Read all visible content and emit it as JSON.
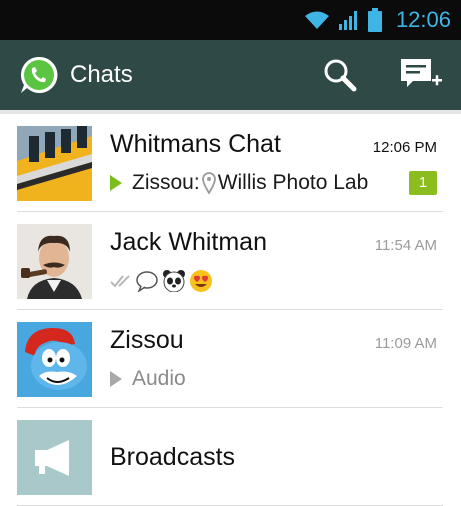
{
  "status_bar": {
    "time": "12:06",
    "icons": [
      "wifi-icon",
      "signal-icon",
      "battery-icon"
    ]
  },
  "action_bar": {
    "title": "Chats",
    "icons": [
      "whatsapp-logo",
      "search-icon",
      "new-chat-icon"
    ]
  },
  "chats": [
    {
      "name": "Whitmans Chat",
      "time": "12:06 PM",
      "sender": "Zissou:",
      "preview": "Willis Photo Lab",
      "unread_count": "1",
      "icons": [
        "play-icon",
        "location-pin-icon"
      ]
    },
    {
      "name": "Jack Whitman",
      "time": "11:54 AM",
      "icons": [
        "double-check-icon",
        "speech-bubble-icon",
        "panda-icon",
        "heart-eyes-icon"
      ]
    },
    {
      "name": "Zissou",
      "time": "11:09 AM",
      "preview": "Audio",
      "icons": [
        "play-icon"
      ]
    },
    {
      "name": "Broadcasts",
      "icons": [
        "megaphone-icon"
      ]
    }
  ],
  "colors": {
    "action_bar": "#2f4a46",
    "status_time": "#3fb5e6",
    "badge": "#8bbd1f",
    "play_green": "#7cbd1a"
  }
}
